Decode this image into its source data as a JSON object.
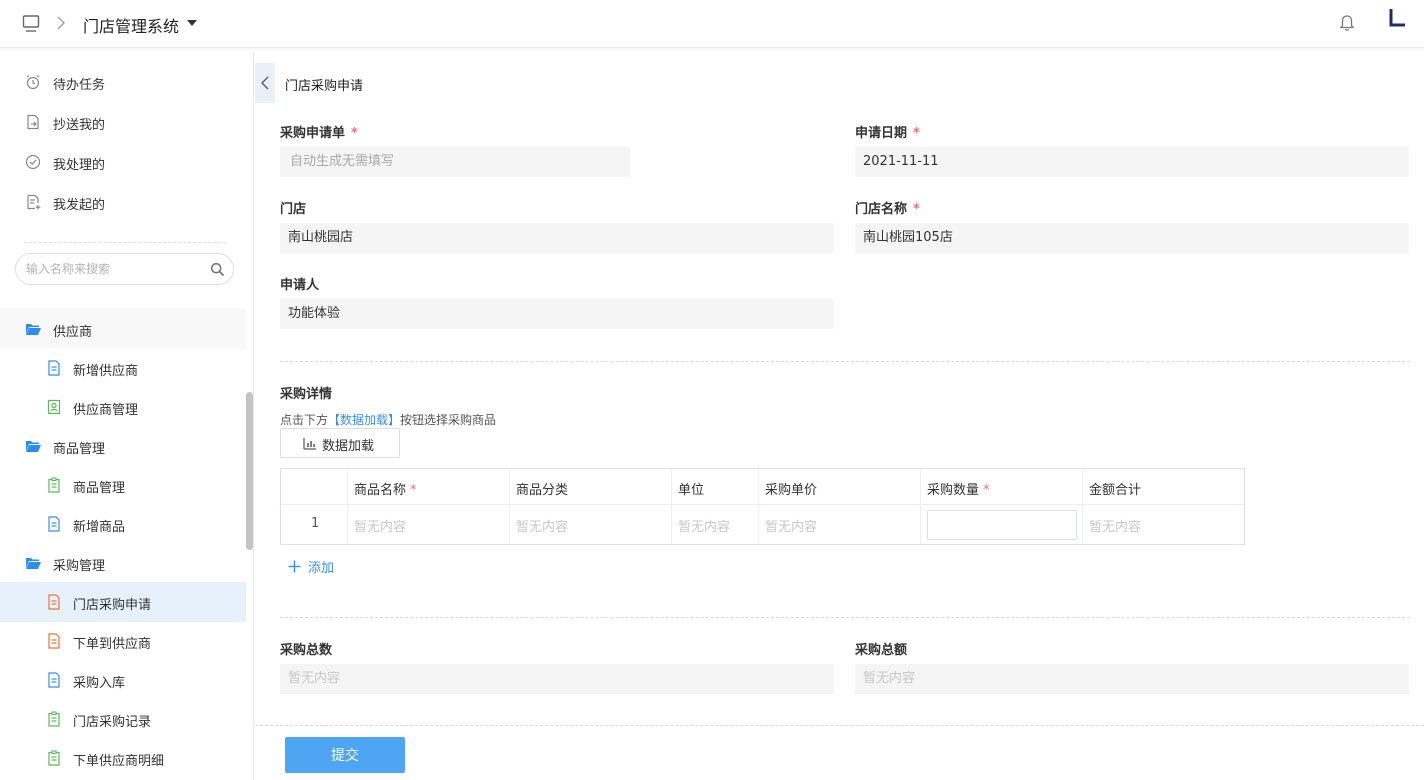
{
  "header": {
    "system_title": "门店管理系统"
  },
  "sidebar": {
    "tasks": [
      {
        "label": "待办任务",
        "icon": "alarm-clock-icon"
      },
      {
        "label": "抄送我的",
        "icon": "forward-doc-icon"
      },
      {
        "label": "我处理的",
        "icon": "check-circle-icon"
      },
      {
        "label": "我发起的",
        "icon": "add-doc-icon"
      }
    ],
    "search_placeholder": "输入名称来搜索",
    "groups": {
      "supplier": {
        "label": "供应商",
        "items": [
          "新增供应商",
          "供应商管理"
        ]
      },
      "product": {
        "label": "商品管理",
        "items": [
          "商品管理",
          "新增商品"
        ]
      },
      "purchase": {
        "label": "采购管理",
        "items": [
          "门店采购申请",
          "下单到供应商",
          "采购入库",
          "门店采购记录",
          "下单供应商明细"
        ]
      }
    },
    "active_item": "门店采购申请"
  },
  "page": {
    "title": "门店采购申请",
    "form": {
      "order_no": {
        "label": "采购申请单",
        "placeholder": "自动生成无需填写"
      },
      "apply_date": {
        "label": "申请日期",
        "value": "2021-11-11"
      },
      "store": {
        "label": "门店",
        "value": "南山桃园店"
      },
      "store_name": {
        "label": "门店名称",
        "value": "南山桃园105店"
      },
      "applicant": {
        "label": "申请人",
        "value": "功能体验"
      }
    },
    "details": {
      "title": "采购详情",
      "hint_prefix": "点击下方",
      "hint_link": "【数据加载】",
      "hint_suffix": "按钮选择采购商品",
      "load_button": "数据加载",
      "columns": [
        "商品名称",
        "商品分类",
        "单位",
        "采购单价",
        "采购数量",
        "金额合计"
      ],
      "rows": [
        {
          "index": "1",
          "name": "暂无内容",
          "category": "暂无内容",
          "unit": "暂无内容",
          "price": "暂无内容",
          "qty": "",
          "amount": "暂无内容"
        }
      ],
      "add_label": "添加"
    },
    "totals": {
      "count": {
        "label": "采购总数",
        "value": "暂无内容"
      },
      "amount": {
        "label": "采购总额",
        "value": "暂无内容"
      }
    },
    "submit_label": "提交"
  },
  "colors": {
    "accent": "#3a8ee6",
    "submit": "#4ea6f2",
    "required": "#f56c6c",
    "active_bg": "#e6f1fc",
    "folder": "#2d8cf0"
  }
}
